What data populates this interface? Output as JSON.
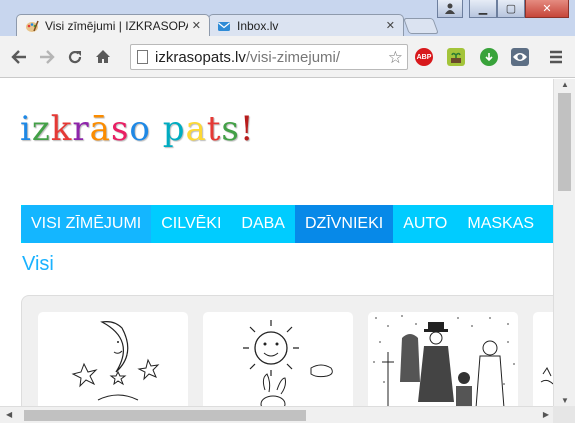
{
  "browser": {
    "tabs": [
      {
        "title": "Visi zīmējumi | IZKRASOPATS",
        "active": true
      },
      {
        "title": "Inbox.lv",
        "active": false
      }
    ],
    "address": {
      "domain": "izkrasopats.lv",
      "path": "/visi-zimejumi/"
    },
    "extensions": [
      {
        "name": "adblock-plus-icon",
        "label": "ABP",
        "color": "#d8191c"
      },
      {
        "name": "plant-extension-icon",
        "label": "",
        "color": "#a3c43a"
      },
      {
        "name": "download-extension-icon",
        "label": "",
        "color": "#39a33b"
      },
      {
        "name": "eye-extension-icon",
        "label": "",
        "color": "#5d6f85"
      }
    ]
  },
  "page": {
    "logo": {
      "letters": [
        {
          "ch": "i",
          "color": "#1e88e5"
        },
        {
          "ch": "z",
          "color": "#43a047"
        },
        {
          "ch": "k",
          "color": "#e53935"
        },
        {
          "ch": "r",
          "color": "#8e24aa"
        },
        {
          "ch": "ā",
          "color": "#fb8c00"
        },
        {
          "ch": "s",
          "color": "#e91e63"
        },
        {
          "ch": "o",
          "color": "#1e88e5"
        },
        {
          "ch": " ",
          "color": "#000000"
        },
        {
          "ch": "p",
          "color": "#00acc1"
        },
        {
          "ch": "a",
          "color": "#fdd835"
        },
        {
          "ch": "t",
          "color": "#e53935"
        },
        {
          "ch": "s",
          "color": "#43a047"
        },
        {
          "ch": "!",
          "color": "#b71c1c"
        }
      ]
    },
    "nav": [
      {
        "label": "VISI ZĪMĒJUMI",
        "key": "visi"
      },
      {
        "label": "CILVĒKI",
        "key": "cilveki"
      },
      {
        "label": "DABA",
        "key": "daba"
      },
      {
        "label": "DZĪVNIEKI",
        "key": "dzivnieki"
      },
      {
        "label": "AUTO",
        "key": "auto"
      },
      {
        "label": "MASKAS",
        "key": "maskas"
      }
    ],
    "heading": "Visi"
  }
}
